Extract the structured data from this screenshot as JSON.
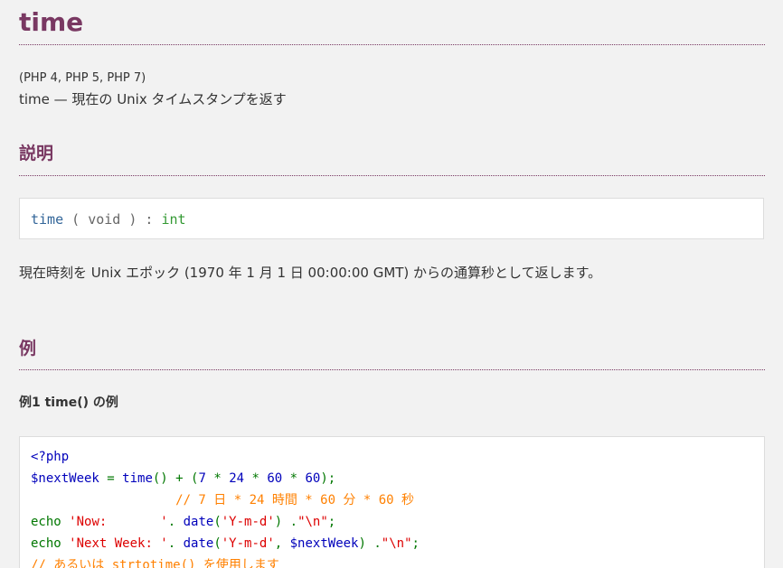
{
  "page": {
    "title": "time",
    "versions": "(PHP 4, PHP 5, PHP 7)",
    "refname": "time — 現在の Unix タイムスタンプを返す"
  },
  "description_section": {
    "heading": "説明",
    "synopsis": {
      "function_name": "time",
      "open_paren": " ( ",
      "param": "void",
      "close_paren": " ) : ",
      "return_type": "int"
    },
    "text": "現在時刻を Unix エポック (1970 年 1 月 1 日 00:00:00 GMT) からの通算秒として返します。"
  },
  "examples_section": {
    "heading": "例",
    "example_title": "例1 time() の例",
    "code": {
      "line1": {
        "tag": "<?php"
      },
      "line2": {
        "var": "$nextWeek",
        "eq": " = ",
        "fn": "time",
        "paren1": "() + (",
        "n1": "7",
        "op1": " * ",
        "n2": "24",
        "op2": " * ",
        "n3": "60",
        "op3": " * ",
        "n4": "60",
        "end": ");"
      },
      "line3": {
        "comment": "                   // 7 日 * 24 時間 * 60 分 * 60 秒"
      },
      "line4": {
        "kw": "echo ",
        "str": "'Now:       '",
        "op": ". ",
        "fn": "date",
        "p1": "(",
        "arg": "'Y-m-d'",
        "p2": ") .",
        "nl": "\"\\n\"",
        "semi": ";"
      },
      "line5": {
        "kw": "echo ",
        "str": "'Next Week: '",
        "op": ". ",
        "fn": "date",
        "p1": "(",
        "arg": "'Y-m-d'",
        "comma": ", ",
        "var": "$nextWeek",
        "p2": ") .",
        "nl": "\"\\n\"",
        "semi": ";"
      },
      "line6": {
        "comment": "// あるいは strtotime() を使用します"
      }
    }
  },
  "colors": {
    "heading": "#793862",
    "function": "#336699",
    "type": "#339933",
    "php_keyword": "#007700",
    "php_string": "#dd0000",
    "php_default": "#0000bb",
    "php_comment": "#ff8000"
  }
}
